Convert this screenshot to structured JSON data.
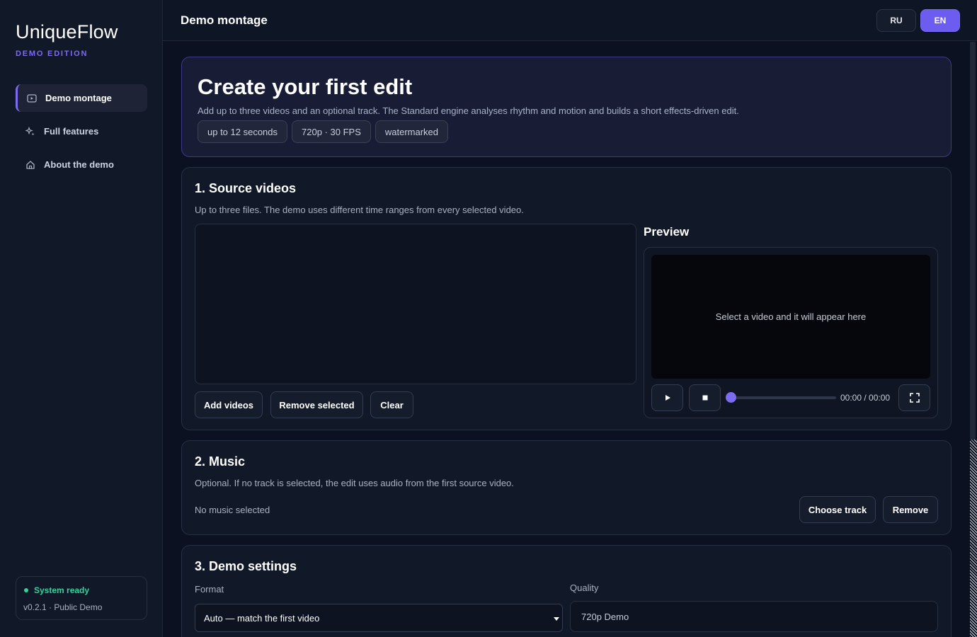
{
  "sidebar": {
    "brand": "UniqueFlow",
    "edition": "DEMO EDITION",
    "items": [
      {
        "label": "Demo montage",
        "icon": "video-icon"
      },
      {
        "label": "Full features",
        "icon": "sparkle-icon"
      },
      {
        "label": "About the demo",
        "icon": "home-icon"
      }
    ],
    "status": "System ready",
    "version": "v0.2.1 · Public Demo"
  },
  "header": {
    "title": "Demo montage",
    "lang_ru": "RU",
    "lang_en": "EN"
  },
  "hero": {
    "title": "Create your first edit",
    "description": "Add up to three videos and an optional track. The Standard engine analyses rhythm and motion and builds a short effects-driven edit.",
    "chips": [
      "up to 12 seconds",
      "720p · 30 FPS",
      "watermarked"
    ]
  },
  "sources": {
    "title": "1. Source videos",
    "description": "Up to three files. The demo uses different time ranges from every selected video.",
    "add_label": "Add videos",
    "remove_label": "Remove selected",
    "clear_label": "Clear",
    "preview_title": "Preview",
    "preview_placeholder": "Select a video and it will appear here",
    "time": "00:00 / 00:00",
    "progress": 0
  },
  "music": {
    "title": "2. Music",
    "description": "Optional. If no track is selected, the edit uses audio from the first source video.",
    "status": "No music selected",
    "choose_label": "Choose track",
    "remove_label": "Remove"
  },
  "settings": {
    "title": "3. Demo settings",
    "format_label": "Format",
    "format_value": "Auto — match the first video",
    "quality_label": "Quality",
    "quality_value": "720p Demo"
  },
  "colors": {
    "accent": "#7c6cf2",
    "status_ok": "#34d399",
    "background": "#0b1120"
  }
}
